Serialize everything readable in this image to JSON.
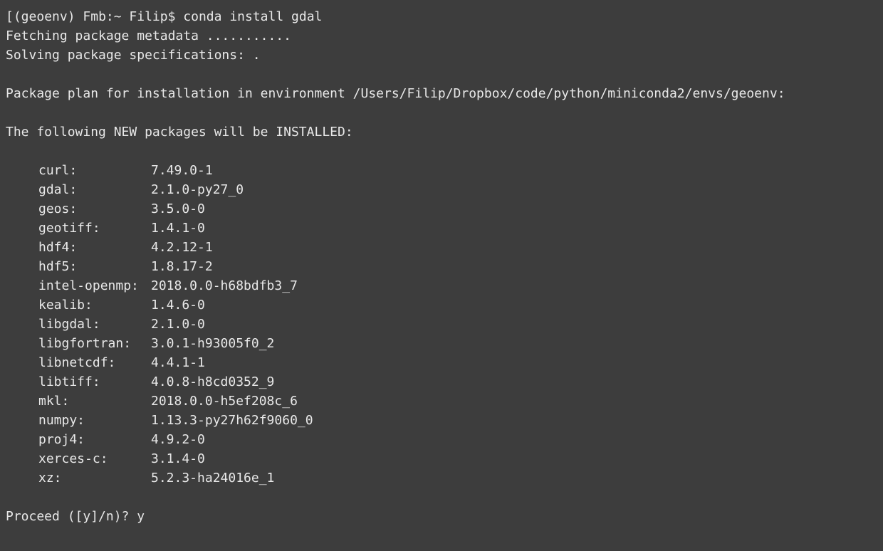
{
  "prompt": {
    "env_prefix": "(geoenv)",
    "host": "Fmb:~",
    "user": "Filip$",
    "command": "conda install gdal"
  },
  "lines": {
    "fetching": "Fetching package metadata ...........",
    "solving": "Solving package specifications: .",
    "package_plan": "Package plan for installation in environment /Users/Filip/Dropbox/code/python/miniconda2/envs/geoenv:",
    "new_packages_header": "The following NEW packages will be INSTALLED:",
    "proceed_prompt": "Proceed ([y]/n)? ",
    "proceed_answer": "y"
  },
  "packages": [
    {
      "name": "curl:",
      "version": "7.49.0-1"
    },
    {
      "name": "gdal:",
      "version": "2.1.0-py27_0"
    },
    {
      "name": "geos:",
      "version": "3.5.0-0"
    },
    {
      "name": "geotiff:",
      "version": "1.4.1-0"
    },
    {
      "name": "hdf4:",
      "version": "4.2.12-1"
    },
    {
      "name": "hdf5:",
      "version": "1.8.17-2"
    },
    {
      "name": "intel-openmp:",
      "version": "2018.0.0-h68bdfb3_7"
    },
    {
      "name": "kealib:",
      "version": "1.4.6-0"
    },
    {
      "name": "libgdal:",
      "version": "2.1.0-0"
    },
    {
      "name": "libgfortran:",
      "version": "3.0.1-h93005f0_2"
    },
    {
      "name": "libnetcdf:",
      "version": "4.4.1-1"
    },
    {
      "name": "libtiff:",
      "version": "4.0.8-h8cd0352_9"
    },
    {
      "name": "mkl:",
      "version": "2018.0.0-h5ef208c_6"
    },
    {
      "name": "numpy:",
      "version": "1.13.3-py27h62f9060_0"
    },
    {
      "name": "proj4:",
      "version": "4.9.2-0"
    },
    {
      "name": "xerces-c:",
      "version": "3.1.4-0"
    },
    {
      "name": "xz:",
      "version": "5.2.3-ha24016e_1"
    }
  ]
}
